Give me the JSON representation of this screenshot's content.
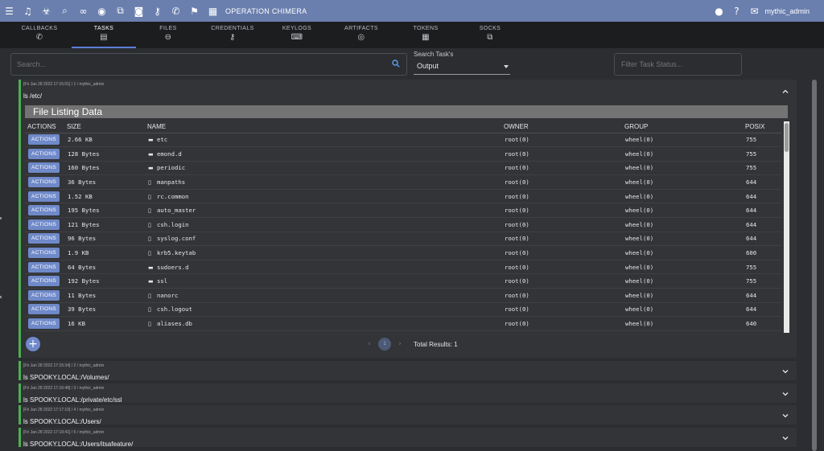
{
  "topbar": {
    "operation_title": "OPERATION CHIMERA",
    "username": "mythic_admin",
    "icons": [
      "menu-icon",
      "headphones-icon",
      "biohazard-icon",
      "search-icon",
      "link-icon",
      "fingerprint-icon",
      "socks-icon",
      "camera-icon",
      "key-icon",
      "phone-icon",
      "flag-icon",
      "table-icon"
    ],
    "right_icons": [
      "account-icon",
      "help-icon",
      "mail-icon"
    ],
    "bar_color": "#6a7fae"
  },
  "tabs": [
    {
      "label": "CALLBACKS",
      "icon": "phone-icon",
      "glyph": "✆",
      "active": false
    },
    {
      "label": "TASKS",
      "icon": "clipboard-icon",
      "glyph": "▤",
      "active": true
    },
    {
      "label": "FILES",
      "icon": "link-icon",
      "glyph": "⊖",
      "active": false
    },
    {
      "label": "CREDENTIALS",
      "icon": "key-icon",
      "glyph": "⚷",
      "active": false
    },
    {
      "label": "KEYLOGS",
      "icon": "keyboard-icon",
      "glyph": "⌨",
      "active": false
    },
    {
      "label": "ARTIFACTS",
      "icon": "fingerprint-icon",
      "glyph": "◎",
      "active": false
    },
    {
      "label": "TOKENS",
      "icon": "token-icon",
      "glyph": "▦",
      "active": false
    },
    {
      "label": "SOCKS",
      "icon": "socks-icon",
      "glyph": "⧉",
      "active": false
    }
  ],
  "search": {
    "placeholder": "Search...",
    "value": ""
  },
  "search_task_select": {
    "label": "Search Task's",
    "value": "Output"
  },
  "filter_status": {
    "placeholder": "Filter Task Status...",
    "value": ""
  },
  "expanded_task": {
    "meta": "[Fri Jan 28 2022 17:15:01] / 1 / mythic_admin",
    "command": "ls /etc/",
    "status_color": "#4caf50",
    "listing_title": "File Listing Data",
    "columns": [
      "ACTIONS",
      "SIZE",
      "NAME",
      "OWNER",
      "GROUP",
      "POSIX"
    ],
    "action_label": "ACTIONS",
    "rows": [
      {
        "size": "2.66 KB",
        "type": "folder",
        "name": "etc",
        "owner": "root(0)",
        "group": "wheel(0)",
        "posix": "755"
      },
      {
        "size": "128 Bytes",
        "type": "folder",
        "name": "emond.d",
        "owner": "root(0)",
        "group": "wheel(0)",
        "posix": "755"
      },
      {
        "size": "160 Bytes",
        "type": "folder",
        "name": "periodic",
        "owner": "root(0)",
        "group": "wheel(0)",
        "posix": "755"
      },
      {
        "size": "36 Bytes",
        "type": "file",
        "name": "manpaths",
        "owner": "root(0)",
        "group": "wheel(0)",
        "posix": "644"
      },
      {
        "size": "1.52 KB",
        "type": "file",
        "name": "rc.common",
        "owner": "root(0)",
        "group": "wheel(0)",
        "posix": "644"
      },
      {
        "size": "195 Bytes",
        "type": "file",
        "name": "auto_master",
        "owner": "root(0)",
        "group": "wheel(0)",
        "posix": "644"
      },
      {
        "size": "121 Bytes",
        "type": "file",
        "name": "csh.login",
        "owner": "root(0)",
        "group": "wheel(0)",
        "posix": "644"
      },
      {
        "size": "96 Bytes",
        "type": "file",
        "name": "syslog.conf",
        "owner": "root(0)",
        "group": "wheel(0)",
        "posix": "644"
      },
      {
        "size": "1.9 KB",
        "type": "file",
        "name": "krb5.keytab",
        "owner": "root(0)",
        "group": "wheel(0)",
        "posix": "600"
      },
      {
        "size": "64 Bytes",
        "type": "folder",
        "name": "sudoers.d",
        "owner": "root(0)",
        "group": "wheel(0)",
        "posix": "755"
      },
      {
        "size": "192 Bytes",
        "type": "folder",
        "name": "ssl",
        "owner": "root(0)",
        "group": "wheel(0)",
        "posix": "755"
      },
      {
        "size": "11 Bytes",
        "type": "file",
        "name": "nanorc",
        "owner": "root(0)",
        "group": "wheel(0)",
        "posix": "644"
      },
      {
        "size": "39 Bytes",
        "type": "file",
        "name": "csh.logout",
        "owner": "root(0)",
        "group": "wheel(0)",
        "posix": "644"
      },
      {
        "size": "16 KB",
        "type": "file",
        "name": "aliases.db",
        "owner": "root(0)",
        "group": "wheel(0)",
        "posix": "640"
      }
    ],
    "pagination": {
      "current_page": "1",
      "total_results": "Total Results: 1"
    }
  },
  "collapsed_tasks": [
    {
      "meta": "[Fri Jan 28 2022 17:15:34] / 2 / mythic_admin",
      "command": "ls SPOOKY.LOCAL:/Volumes/"
    },
    {
      "meta": "[Fri Jan 28 2022 17:16:48] / 3 / mythic_admin",
      "command": "ls SPOOKY.LOCAL:/private/etc/ssl"
    },
    {
      "meta": "[Fri Jan 28 2022 17:17:10] / 4 / mythic_admin",
      "command": "ls SPOOKY.LOCAL:/Users/"
    },
    {
      "meta": "[Fri Jan 28 2022 17:19:41] / 5 / mythic_admin",
      "command": "ls SPOOKY.LOCAL:/Users/itsafeature/"
    }
  ]
}
